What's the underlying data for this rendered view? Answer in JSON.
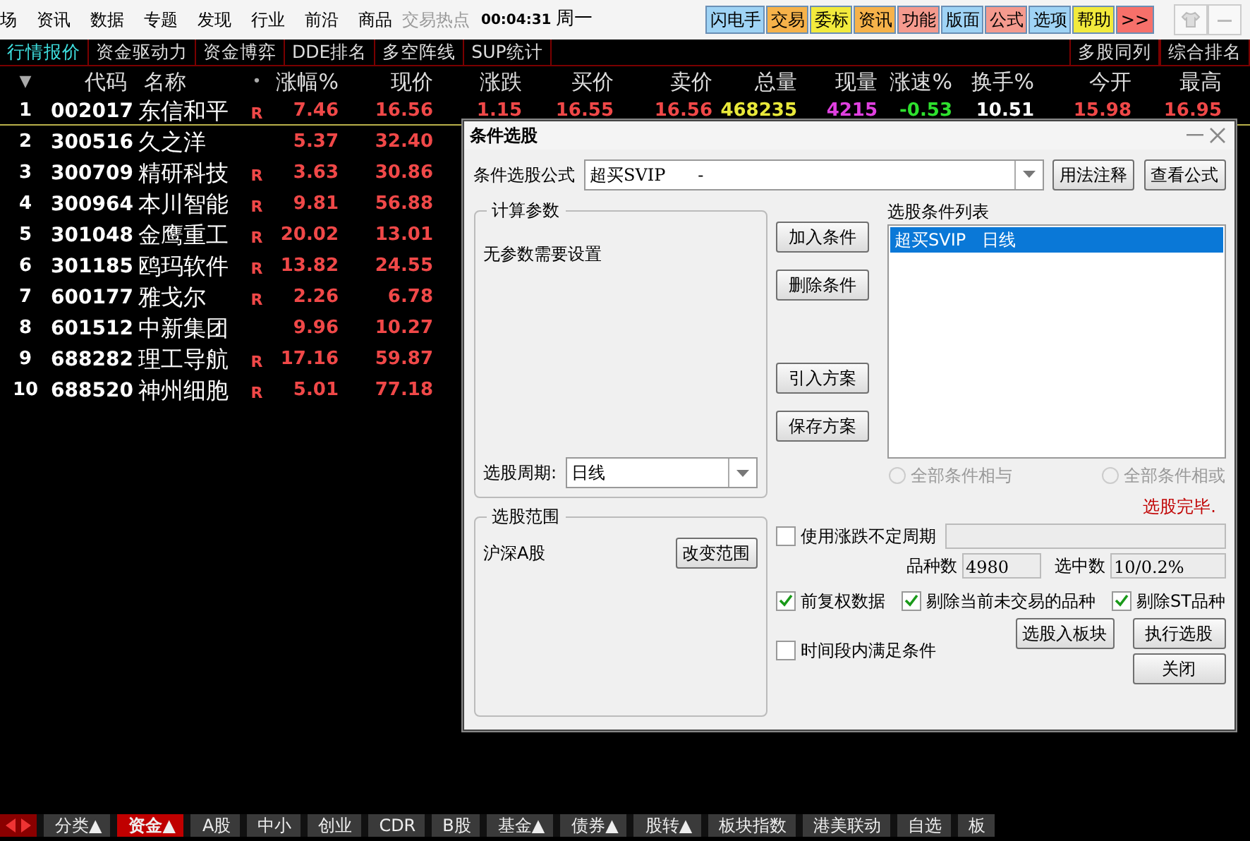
{
  "menu": {
    "items": [
      "场",
      "资讯",
      "数据",
      "专题",
      "发现",
      "行业",
      "前沿",
      "商品"
    ],
    "ghost_text": "交易热点",
    "clock": "00:04:31",
    "weekday": "周一"
  },
  "toolbar": [
    {
      "label": "闪电手",
      "color": "#9fd3f5"
    },
    {
      "label": "交易",
      "color": "#f6b24a"
    },
    {
      "label": "委标",
      "color": "#f2ea3c"
    },
    {
      "label": "资讯",
      "color": "#f6b24a"
    },
    {
      "label": "功能",
      "color": "#f49a8e"
    },
    {
      "label": "版面",
      "color": "#9fd3f5"
    },
    {
      "label": "公式",
      "color": "#f49a8e"
    },
    {
      "label": "选项",
      "color": "#9fd3f5"
    },
    {
      "label": "帮助",
      "color": "#f2ea3c"
    },
    {
      "label": ">>",
      "color": "#f6706a"
    }
  ],
  "tabs": [
    {
      "label": "行情报价",
      "selected": true
    },
    {
      "label": "资金驱动力",
      "selected": false
    },
    {
      "label": "资金博弈",
      "selected": false
    },
    {
      "label": "DDE排名",
      "selected": false
    },
    {
      "label": "多空阵线",
      "selected": false
    },
    {
      "label": "SUP统计",
      "selected": false
    }
  ],
  "tabs_right": [
    "多股同列",
    "综合排名"
  ],
  "table": {
    "columns": [
      "▼",
      "代码",
      "名称",
      "•",
      "涨幅%",
      "现价",
      "涨跌",
      "买价",
      "卖价",
      "总量",
      "现量",
      "涨速%",
      "换手%",
      "今开",
      "最高"
    ],
    "rows": [
      {
        "index": "1",
        "code": "002017",
        "name": "东信和平",
        "flag": "R",
        "selected": true,
        "values": [
          "7.46",
          "16.56",
          "1.15",
          "16.55",
          "16.56",
          "468235",
          "4215",
          "-0.53",
          "10.51",
          "15.98",
          "16.95"
        ]
      },
      {
        "index": "2",
        "code": "300516",
        "name": "久之洋",
        "selected": false,
        "values": [
          "5.37",
          "32.40"
        ]
      },
      {
        "index": "3",
        "code": "300709",
        "name": "精研科技",
        "flag": "R",
        "selected": false,
        "values": [
          "3.63",
          "30.86"
        ]
      },
      {
        "index": "4",
        "code": "300964",
        "name": "本川智能",
        "flag": "R",
        "selected": false,
        "values": [
          "9.81",
          "56.88"
        ]
      },
      {
        "index": "5",
        "code": "301048",
        "name": "金鹰重工",
        "flag": "R",
        "selected": false,
        "values": [
          "20.02",
          "13.01"
        ]
      },
      {
        "index": "6",
        "code": "301185",
        "name": "鸥玛软件",
        "flag": "R",
        "selected": false,
        "values": [
          "13.82",
          "24.55"
        ]
      },
      {
        "index": "7",
        "code": "600177",
        "name": "雅戈尔",
        "flag": "R",
        "selected": false,
        "values": [
          "2.26",
          "6.78"
        ]
      },
      {
        "index": "8",
        "code": "601512",
        "name": "中新集团",
        "selected": false,
        "values": [
          "9.96",
          "10.27"
        ]
      },
      {
        "index": "9",
        "code": "688282",
        "name": "理工导航",
        "flag": "R",
        "selected": false,
        "values": [
          "17.16",
          "59.87"
        ]
      },
      {
        "index": "10",
        "code": "688520",
        "name": "神州细胞",
        "flag": "R",
        "selected": false,
        "values": [
          "5.01",
          "77.18"
        ]
      }
    ]
  },
  "dialog": {
    "title": "条件选股",
    "formula_label": "条件选股公式",
    "formula_value": "超买SVIP      -",
    "formula_buttons": [
      "用法注释",
      "查看公式"
    ],
    "params_group": "计算参数",
    "params_text": "无参数需要设置",
    "period_label": "选股周期:",
    "period_value": "日线",
    "action_buttons": [
      "加入条件",
      "删除条件",
      "引入方案",
      "保存方案"
    ],
    "list_label": "选股条件列表",
    "list_items": [
      {
        "label": "超买SVIP   日线",
        "selected": true
      }
    ],
    "radios": [
      {
        "label": "全部条件相与",
        "selected": false,
        "disabled": true
      },
      {
        "label": "全部条件相或",
        "selected": false,
        "disabled": true
      }
    ],
    "status": "选股完毕.",
    "variable_period": {
      "label": "使用涨跌不定周期",
      "checked": false
    },
    "count_label": "品种数",
    "count_value": "4980",
    "selected_label": "选中数",
    "selected_value": "10/0.2%",
    "options": [
      {
        "label": "前复权数据",
        "checked": true
      },
      {
        "label": "剔除当前未交易的品种",
        "checked": true
      },
      {
        "label": "剔除ST品种",
        "checked": true
      }
    ],
    "time_option": {
      "label": "时间段内满足条件",
      "checked": false
    },
    "bottom_buttons": [
      "选股入板块",
      "执行选股",
      "关闭"
    ],
    "range_group": "选股范围",
    "range_text": "沪深A股",
    "range_button": "改变范围"
  },
  "bottom_tabs": [
    {
      "label": "分类▲",
      "selected": false
    },
    {
      "label": "资金▲",
      "selected": true
    },
    {
      "label": "A股",
      "selected": false
    },
    {
      "label": "中小",
      "selected": false
    },
    {
      "label": "创业",
      "selected": false
    },
    {
      "label": "CDR",
      "selected": false
    },
    {
      "label": "B股",
      "selected": false
    },
    {
      "label": "基金▲",
      "selected": false
    },
    {
      "label": "债券▲",
      "selected": false
    },
    {
      "label": "股转▲",
      "selected": false
    },
    {
      "label": "板块指数",
      "selected": false
    },
    {
      "label": "港美联动",
      "selected": false
    },
    {
      "label": "自选",
      "selected": false
    },
    {
      "label": "板",
      "selected": false
    }
  ]
}
